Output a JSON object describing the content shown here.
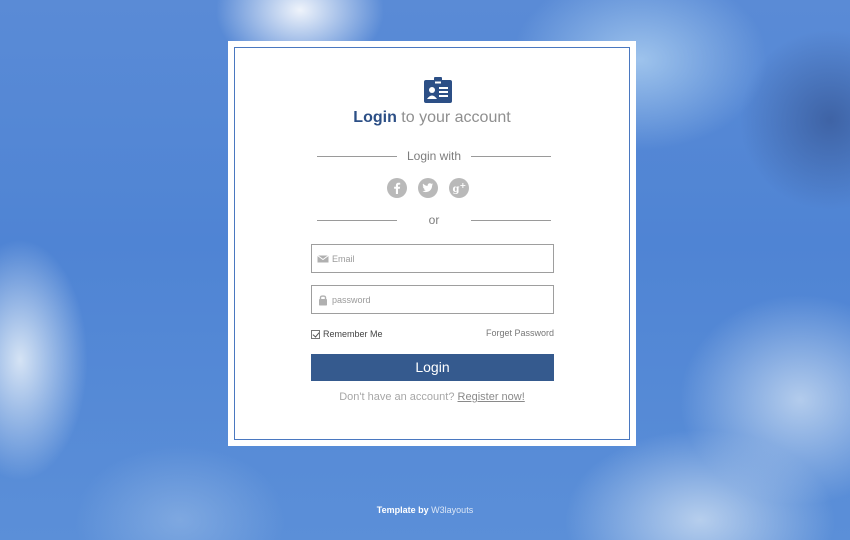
{
  "colors": {
    "brand": "#2c4f86",
    "button": "#355a8e",
    "frame": "#4a78c0",
    "social": "#b9b9b9"
  },
  "header": {
    "icon": "id-badge-icon",
    "title_strong": "Login",
    "title_rest": "to your account"
  },
  "social_section": {
    "label": "Login with",
    "buttons": [
      {
        "icon": "facebook-icon",
        "glyph": "f"
      },
      {
        "icon": "twitter-icon",
        "glyph": "🐦"
      },
      {
        "icon": "google-plus-icon",
        "glyph": "g+"
      }
    ],
    "or_label": "or"
  },
  "form": {
    "email_placeholder": "Email",
    "email_value": "",
    "password_placeholder": "password",
    "password_value": "",
    "remember_label": "Remember Me",
    "remember_checked": true,
    "forget_label": "Forget Password",
    "login_label": "Login"
  },
  "register": {
    "prompt": "Don't have an account?",
    "link": "Register now!"
  },
  "footer": {
    "prefix": "Template by",
    "brand": "W3layouts"
  }
}
